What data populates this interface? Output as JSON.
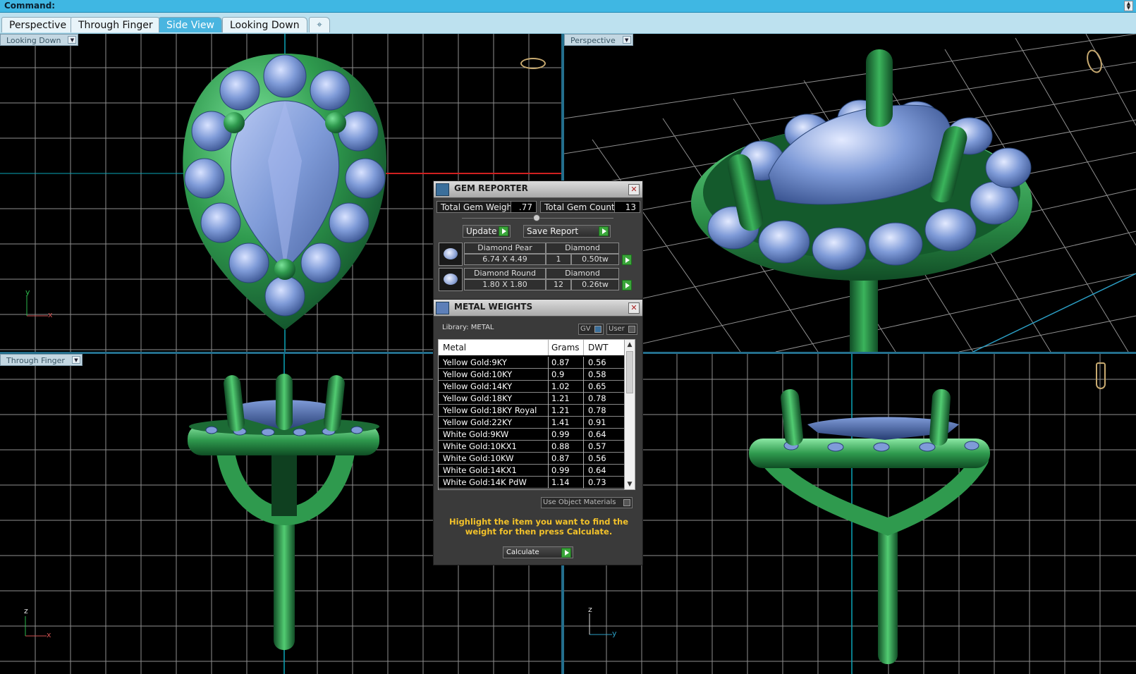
{
  "command_bar": {
    "label": "Command:"
  },
  "tabs": [
    {
      "label": "Perspective",
      "active": false
    },
    {
      "label": "Through Finger",
      "active": false
    },
    {
      "label": "Side View",
      "active": true
    },
    {
      "label": "Looking Down",
      "active": false
    }
  ],
  "tab_add_icon": "plus-icon",
  "viewports": {
    "top_left": {
      "label": "Looking Down",
      "axes": [
        "y",
        "x"
      ]
    },
    "top_right": {
      "label": "Perspective"
    },
    "bottom_left": {
      "label": "Through Finger",
      "axes": [
        "z",
        "x"
      ]
    },
    "bottom_right": {
      "label": "",
      "axes": [
        "z",
        "y"
      ]
    }
  },
  "gem_reporter": {
    "title": "GEM REPORTER",
    "total_gem_weight_label": "Total Gem Weight",
    "total_gem_weight": ".77",
    "total_gem_count_label": "Total Gem Count",
    "total_gem_count": "13",
    "update_label": "Update",
    "save_report_label": "Save Report",
    "gems": [
      {
        "name": "Diamond Pear",
        "material": "Diamond",
        "size": "6.74 X 4.49",
        "count": "1",
        "weight": "0.50tw"
      },
      {
        "name": "Diamond Round",
        "material": "Diamond",
        "size": "1.80 X 1.80",
        "count": "12",
        "weight": "0.26tw"
      }
    ]
  },
  "metal_weights": {
    "title": "METAL WEIGHTS",
    "library_label": "Library: METAL",
    "gv_label": "GV",
    "user_label": "User",
    "columns": [
      "Metal",
      "Grams",
      "DWT"
    ],
    "rows": [
      [
        "Yellow Gold:9KY",
        "0.87",
        "0.56"
      ],
      [
        "Yellow Gold:10KY",
        "0.9",
        "0.58"
      ],
      [
        "Yellow Gold:14KY",
        "1.02",
        "0.65"
      ],
      [
        "Yellow Gold:18KY",
        "1.21",
        "0.78"
      ],
      [
        "Yellow Gold:18KY Royal",
        "1.21",
        "0.78"
      ],
      [
        "Yellow Gold:22KY",
        "1.41",
        "0.91"
      ],
      [
        "White Gold:9KW",
        "0.99",
        "0.64"
      ],
      [
        "White Gold:10KX1",
        "0.88",
        "0.57"
      ],
      [
        "White Gold:10KW",
        "0.87",
        "0.56"
      ],
      [
        "White Gold:14KX1",
        "0.99",
        "0.64"
      ],
      [
        "White Gold:14K PdW",
        "1.14",
        "0.73"
      ]
    ],
    "use_object_materials_label": "Use Object Materials",
    "hint": "Highlight the item you want to find the weight for then press Calculate.",
    "calculate_label": "Calculate"
  },
  "colors": {
    "metal_green": "#2f9a4e",
    "gem_blue": "#7f9bd8",
    "grid_line": "#9a9a9a",
    "accent_blue": "#3fb7e3",
    "hint_yellow": "#f3c22a"
  }
}
